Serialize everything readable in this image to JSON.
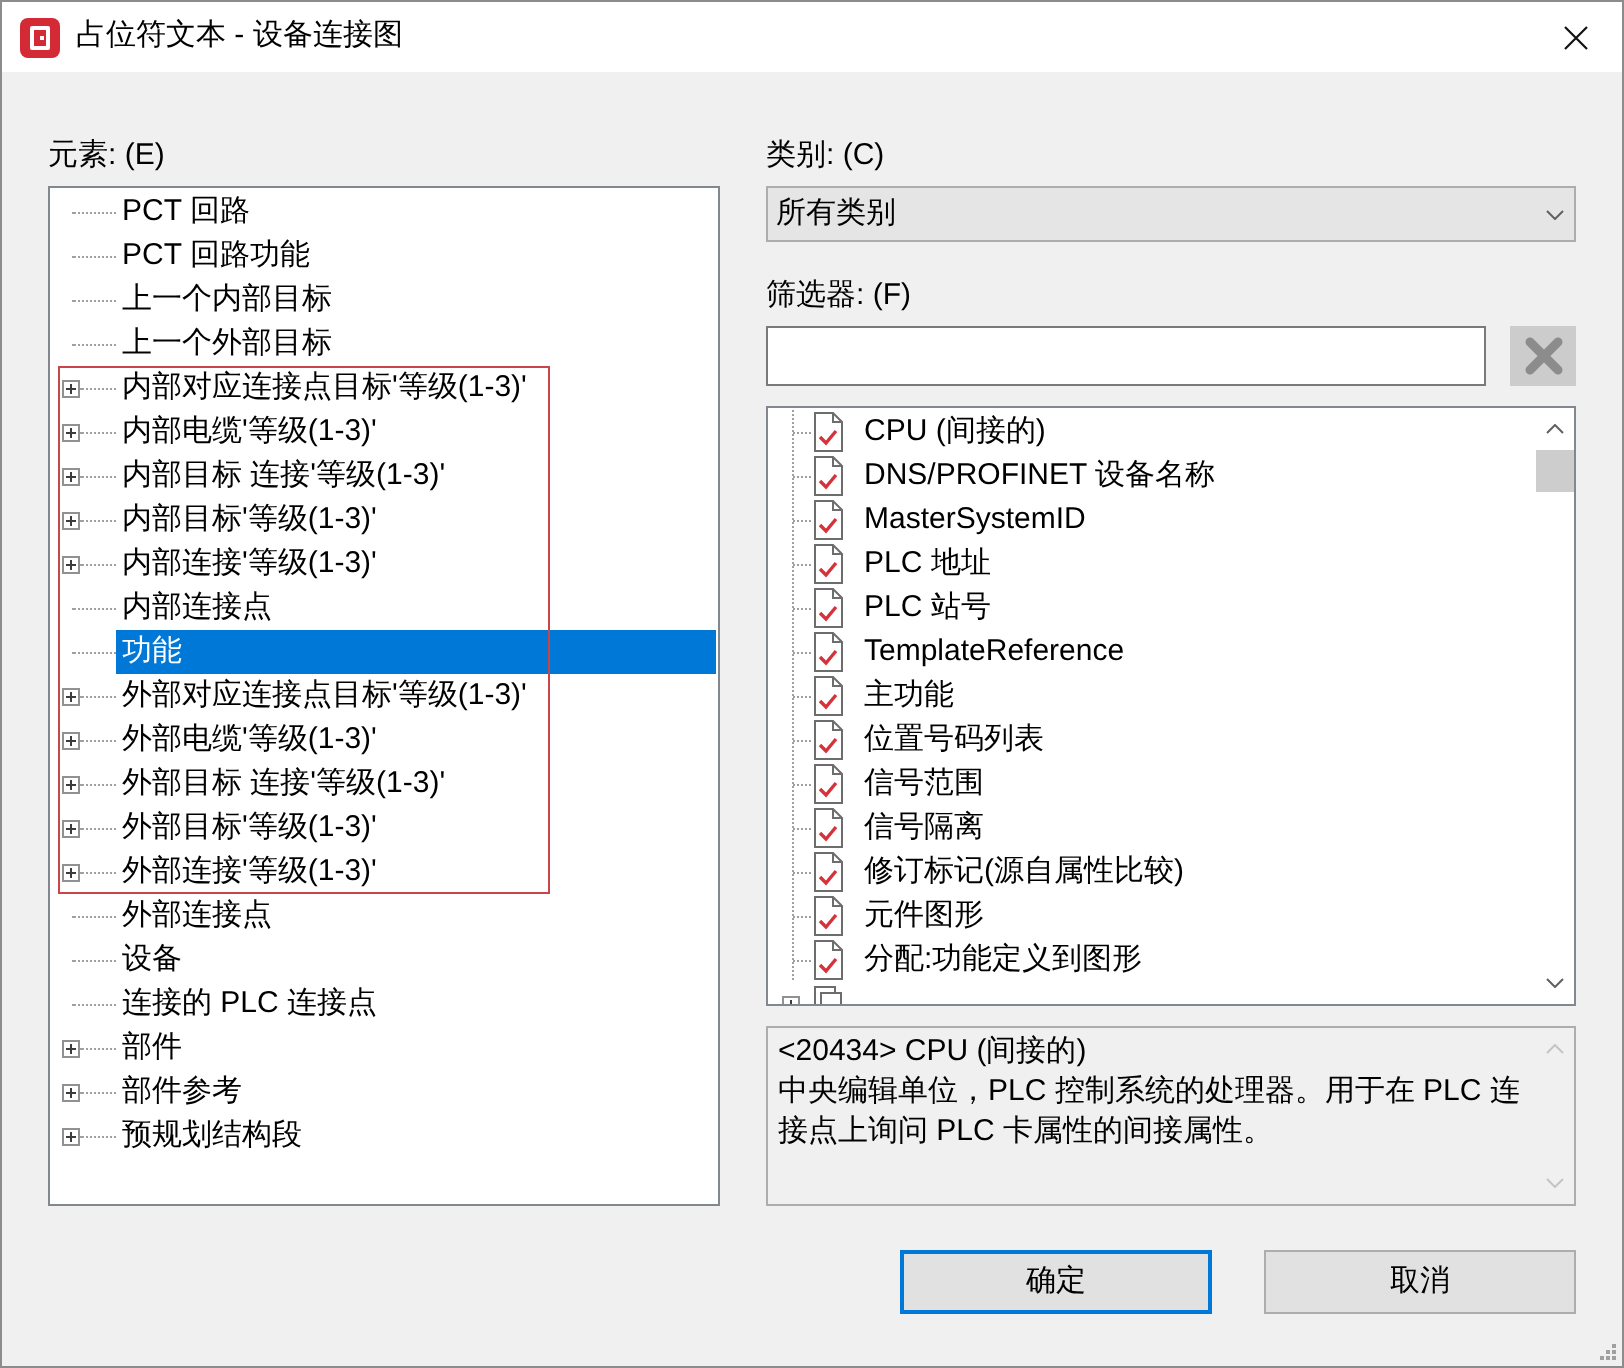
{
  "window": {
    "title": "占位符文本 - 设备连接图"
  },
  "elements": {
    "label": "元素: (E)",
    "items": [
      {
        "kind": "leaf",
        "label": "PCT 回路",
        "selected": false
      },
      {
        "kind": "leaf",
        "label": "PCT 回路功能",
        "selected": false
      },
      {
        "kind": "leaf",
        "label": "上一个内部目标",
        "selected": false
      },
      {
        "kind": "leaf",
        "label": "上一个外部目标",
        "selected": false
      },
      {
        "kind": "frame",
        "items": [
          {
            "kind": "group",
            "label": "内部对应连接点目标'等级(1-3)'",
            "selected": false
          },
          {
            "kind": "group",
            "label": "内部电缆'等级(1-3)'",
            "selected": false
          },
          {
            "kind": "group",
            "label": "内部目标 连接'等级(1-3)'",
            "selected": false
          },
          {
            "kind": "group",
            "label": "内部目标'等级(1-3)'",
            "selected": false
          },
          {
            "kind": "group",
            "label": "内部连接'等级(1-3)'",
            "selected": false
          },
          {
            "kind": "leaf",
            "label": "内部连接点",
            "selected": false
          },
          {
            "kind": "leaf",
            "label": "功能",
            "selected": true
          },
          {
            "kind": "group",
            "label": "外部对应连接点目标'等级(1-3)'",
            "selected": false
          },
          {
            "kind": "group",
            "label": "外部电缆'等级(1-3)'",
            "selected": false
          },
          {
            "kind": "group",
            "label": "外部目标 连接'等级(1-3)'",
            "selected": false
          },
          {
            "kind": "group",
            "label": "外部目标'等级(1-3)'",
            "selected": false
          },
          {
            "kind": "group",
            "label": "外部连接'等级(1-3)'",
            "selected": false
          }
        ]
      },
      {
        "kind": "leaf",
        "label": "外部连接点",
        "selected": false
      },
      {
        "kind": "leaf",
        "label": "设备",
        "selected": false
      },
      {
        "kind": "leaf",
        "label": "连接的 PLC 连接点",
        "selected": false
      },
      {
        "kind": "group",
        "label": "部件",
        "selected": false
      },
      {
        "kind": "group",
        "label": "部件参考",
        "selected": false
      },
      {
        "kind": "group",
        "label": "预规划结构段",
        "selected": false
      }
    ]
  },
  "category": {
    "label": "类别: (C)",
    "value": "所有类别"
  },
  "filter": {
    "label": "筛选器: (F)",
    "clear_disabled": true
  },
  "properties": [
    {
      "kind": "leaf",
      "label": "CPU (间接的)"
    },
    {
      "kind": "leaf",
      "label": "DNS/PROFINET 设备名称"
    },
    {
      "kind": "leaf",
      "label": "MasterSystemID"
    },
    {
      "kind": "leaf",
      "label": "PLC 地址"
    },
    {
      "kind": "leaf",
      "label": "PLC 站号"
    },
    {
      "kind": "leaf",
      "label": "TemplateReference"
    },
    {
      "kind": "leaf",
      "label": "主功能"
    },
    {
      "kind": "leaf",
      "label": "位置号码列表"
    },
    {
      "kind": "leaf",
      "label": "信号范围"
    },
    {
      "kind": "leaf",
      "label": "信号隔离"
    },
    {
      "kind": "leaf",
      "label": "修订标记(源自属性比较)"
    },
    {
      "kind": "leaf",
      "label": "元件图形"
    },
    {
      "kind": "leaf",
      "label": "分配:功能定义到图形"
    },
    {
      "kind": "group"
    }
  ],
  "description": {
    "heading": "<20434> CPU (间接的)",
    "text": "中央编辑单位，PLC 控制系统的处理器。用于在 PLC 连接点上询问 PLC 卡属性的间接属性。"
  },
  "buttons": [
    {
      "label": "确定",
      "default": true
    },
    {
      "label": "取消",
      "default": false
    }
  ]
}
